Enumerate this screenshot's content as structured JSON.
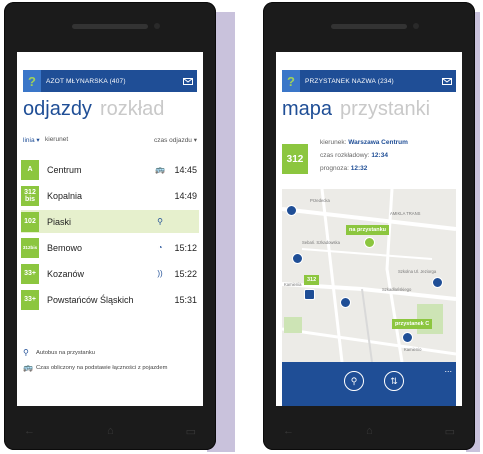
{
  "left_phone": {
    "header_title": "AZOT MŁYNARSKA (407)",
    "pivot_active": "odjazdy",
    "pivot_inactive": "rozkład",
    "col_line": "linia ▾",
    "col_direction": "kierunet",
    "col_time": "czas odjazdu ▾",
    "rows": [
      {
        "line": "A",
        "dest": "Centrum",
        "icon": "realtime-vehicle-icon",
        "icon_char": "🚌",
        "time": "14:45"
      },
      {
        "line": "312\nbis",
        "dest": "Kopalnia",
        "icon": "",
        "icon_char": "",
        "time": "14:49"
      },
      {
        "line": "102",
        "dest": "Piaski",
        "icon": "bus-at-stop-icon",
        "icon_char": "⚲",
        "time": ""
      },
      {
        "line": "312bis",
        "dest": "Bemowo",
        "icon": "clock-icon",
        "icon_char": "◔",
        "time": "15:12"
      },
      {
        "line": "33+",
        "dest": "Kozanów",
        "icon": "signal-icon",
        "icon_char": "))",
        "time": "15:22"
      },
      {
        "line": "33+",
        "dest": "Powstańców Śląskich",
        "icon": "",
        "icon_char": "",
        "time": "15:31"
      }
    ],
    "legend": [
      {
        "icon": "bus-at-stop-icon",
        "icon_char": "⚲",
        "text": "Autobus na przystanku"
      },
      {
        "icon": "realtime-vehicle-icon",
        "icon_char": "🚌",
        "text": "Czas obliczony na podstawie łączności z pojazdem"
      }
    ]
  },
  "right_phone": {
    "header_title": "PRZYSTANEK NAZWA (234)",
    "pivot_active": "mapa",
    "pivot_inactive": "przystanki",
    "info_line": "312",
    "direction_label": "kierunek:",
    "direction_value": "Warszawa Centrum",
    "scheduled_label": "czas rozkładowy:",
    "scheduled_value": "12:34",
    "forecast_label": "prognoza:",
    "forecast_value": "12:32",
    "map_labels": {
      "stop_label_1": "na przystanku",
      "bus_label": "312",
      "stop_label_2": "przystanek C"
    },
    "streets": [
      "Przedecka",
      "Sebań. Szkadowska",
      "Kamienia",
      "Szkadłańskiego",
      "Kamienio",
      "Szkolna Ul. Jeziorga",
      "AMIKLA TRANS"
    ],
    "appbar_dots": "..."
  },
  "colors": {
    "brand_blue": "#1f4e96",
    "line_green": "#8cc63f",
    "highlight": "#e6f0cd"
  }
}
